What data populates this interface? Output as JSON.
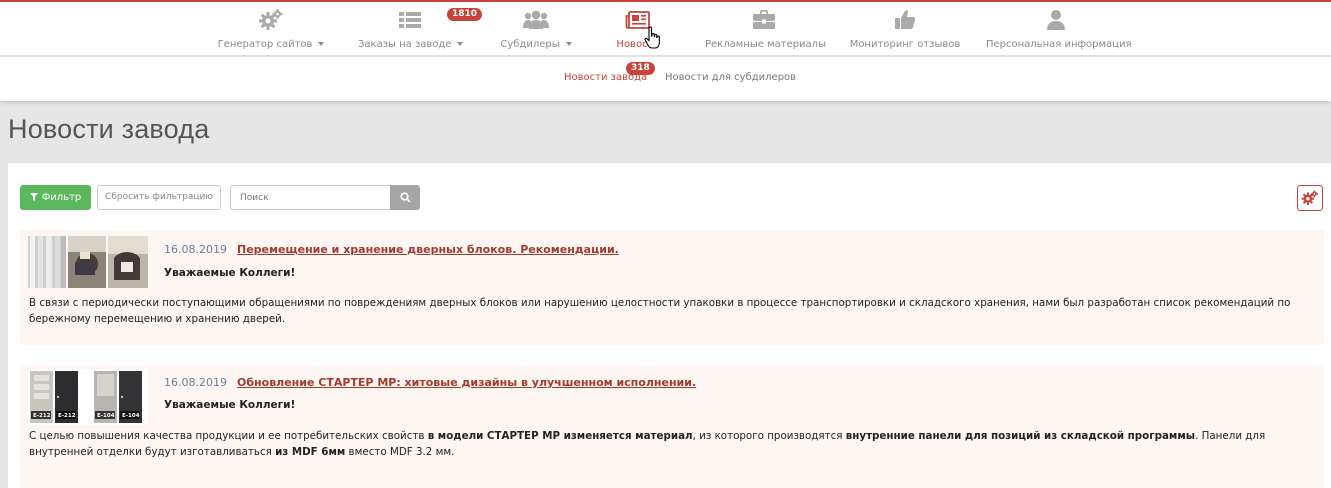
{
  "nav": {
    "items": [
      {
        "label": "Генератор сайтов",
        "icon": "gears-icon",
        "has_dropdown": true
      },
      {
        "label": "Заказы на заводе",
        "icon": "list-icon",
        "has_dropdown": true,
        "badge": "1810"
      },
      {
        "label": "Субдилеры",
        "icon": "users-icon",
        "has_dropdown": true
      },
      {
        "label": "Новос",
        "icon": "newspaper-icon",
        "has_dropdown": true,
        "active": true
      },
      {
        "label": "Рекламные материалы",
        "icon": "briefcase-icon",
        "has_dropdown": false
      },
      {
        "label": "Мониторинг отзывов",
        "icon": "thumbs-up-icon",
        "has_dropdown": false
      },
      {
        "label": "Персональная информация",
        "icon": "user-icon",
        "has_dropdown": false
      }
    ]
  },
  "subnav": {
    "tabs": [
      {
        "label": "Новости завода",
        "badge": "318",
        "active": true
      },
      {
        "label": "Новости для субдилеров",
        "active": false
      }
    ]
  },
  "page": {
    "title": "Новости завода"
  },
  "toolbar": {
    "filter_label": "Фильтр",
    "reset_label": "Сбросить фильтрацию",
    "search_placeholder": "Поиск"
  },
  "news": [
    {
      "date": "16.08.2019",
      "title": "Перемещение и хранение дверных блоков. Рекомендации.",
      "greeting": "Уважаемые Коллеги!",
      "text": "В связи с периодически поступающими обращениями по повреждениям дверных блоков или нарушению целостности упаковки в процессе транспортировки и складского хранения, нами был разработан список рекомендаций по бережному перемещению и хранению дверей."
    },
    {
      "date": "16.08.2019",
      "title": "Обновление СТАРТЕР МР: хитовые дизайны в улучшенном исполнении.",
      "greeting": "Уважаемые Коллеги!",
      "text_parts": [
        "С целью повышения качества продукции и ее потребительских свойств ",
        "в модели СТАРТЕР МР изменяется материал",
        ", из которого производятся ",
        "внутренние панели для позиций из складской программы",
        ". Панели для внутренней отделки будут изготавливаться ",
        "из MDF 6мм",
        " вместо MDF 3.2 мм."
      ],
      "door_labels": [
        "E-212",
        "E-212",
        "E-104",
        "E-104"
      ]
    }
  ],
  "colors": {
    "accent": "#c8433b",
    "filter_button": "#5cb85c",
    "news_bg": "#fdf6f2",
    "link": "#a23b2e"
  }
}
